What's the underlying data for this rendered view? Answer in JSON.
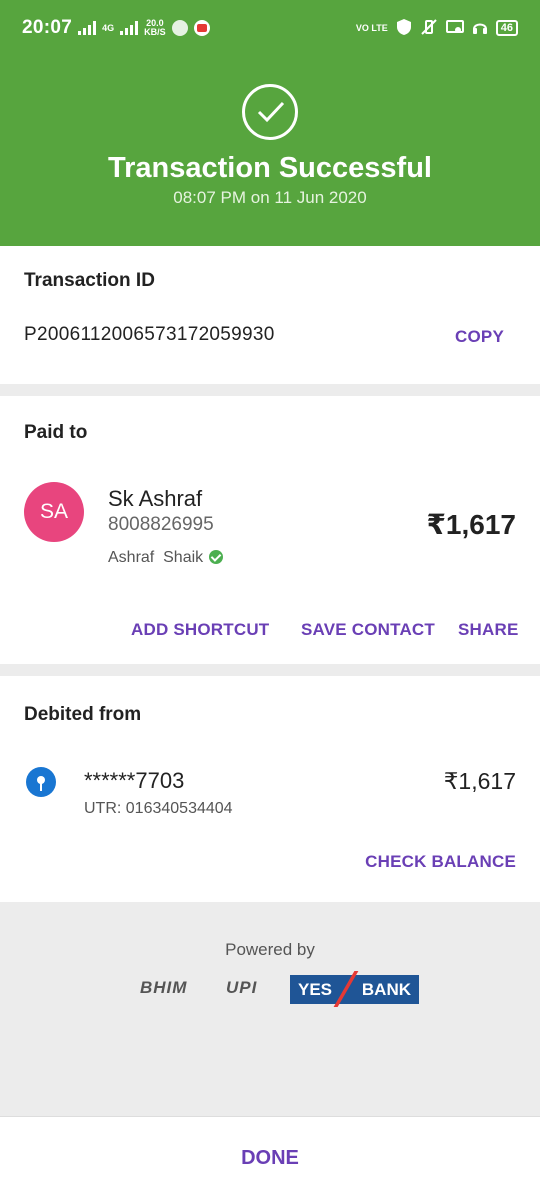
{
  "status_bar": {
    "time": "20:07",
    "net_type": "4G",
    "data_speed": "20.0",
    "data_unit": "KB/S",
    "volte": "VO LTE",
    "battery": "46"
  },
  "header": {
    "title": "Transaction Successful",
    "subtitle": "08:07 PM on 11 Jun 2020",
    "bg_color": "#57a53e"
  },
  "transaction": {
    "label": "Transaction ID",
    "id": "P2006112006573172059930",
    "copy_label": "COPY"
  },
  "paid_to": {
    "label": "Paid to",
    "avatar_initials": "SA",
    "name": "Sk Ashraf",
    "phone": "8008826995",
    "bank_name": "Ashraf  Shaik",
    "amount": "₹1,617",
    "actions": [
      "ADD SHORTCUT",
      "SAVE CONTACT",
      "SHARE"
    ]
  },
  "debited_from": {
    "label": "Debited from",
    "account": "******7703",
    "utr": "UTR: 016340534404",
    "amount": "₹1,617",
    "check_balance": "CHECK BALANCE"
  },
  "powered_by": {
    "text": "Powered by",
    "logo_bhim": "BHIM",
    "logo_upi": "UPI",
    "logo_yes": "YES",
    "logo_bank": "BANK"
  },
  "footer": {
    "done_label": "DONE"
  },
  "colors": {
    "accent": "#6a3fb5",
    "avatar": "#e8457e",
    "verified": "#4caf50"
  }
}
